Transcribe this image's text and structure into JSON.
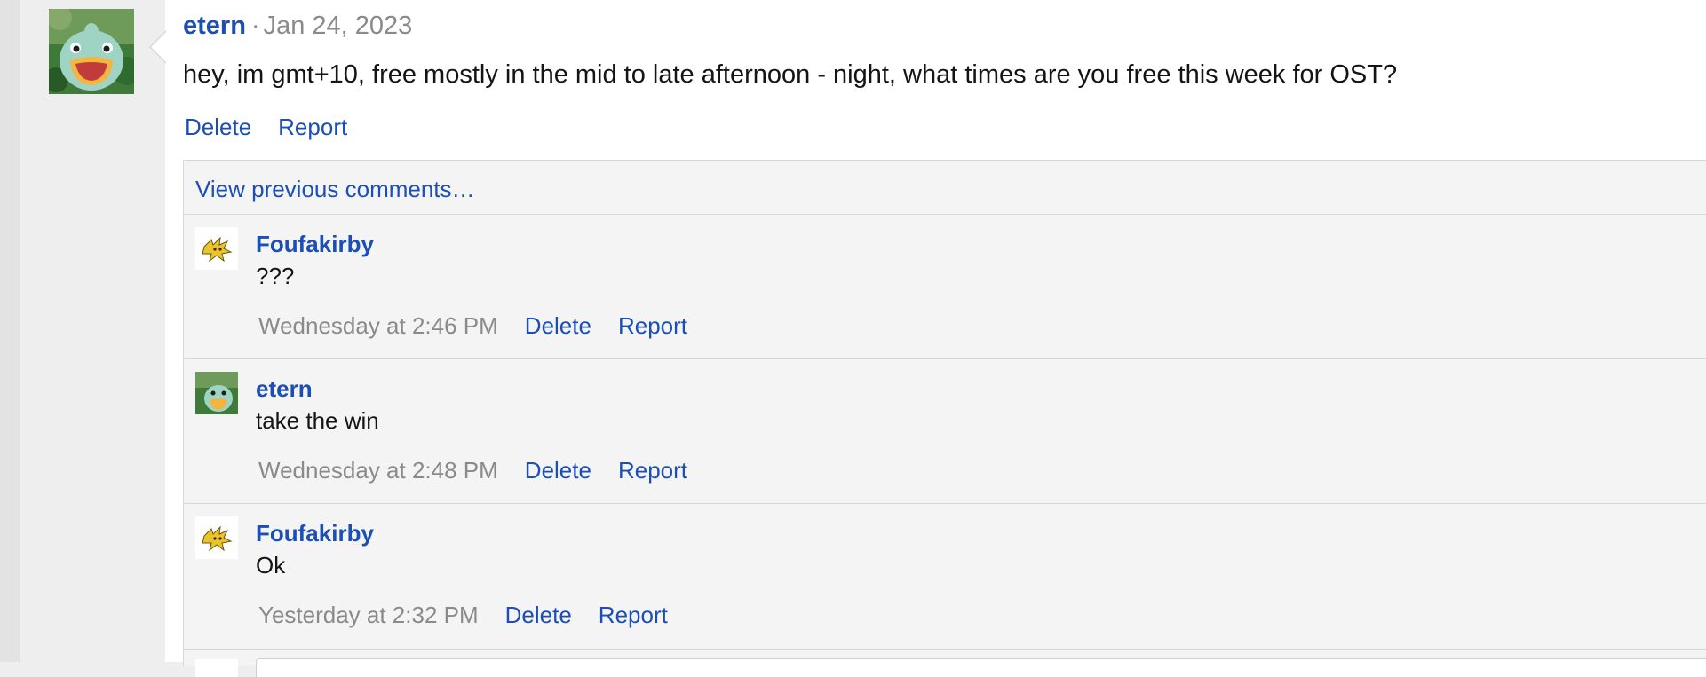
{
  "post": {
    "author": "etern",
    "separator": "·",
    "date": "Jan 24, 2023",
    "body": "hey, im gmt+10, free mostly in the mid to late afternoon - night, what times are you free this week for OST?",
    "actions": {
      "delete": "Delete",
      "report": "Report"
    }
  },
  "comments_section": {
    "view_previous": "View previous comments…",
    "comments": [
      {
        "author": "Foufakirby",
        "text": "???",
        "time": "Wednesday at 2:46 PM",
        "delete": "Delete",
        "report": "Report",
        "avatar": "pokemon-avatar-yellow"
      },
      {
        "author": "etern",
        "text": "take the win",
        "time": "Wednesday at 2:48 PM",
        "delete": "Delete",
        "report": "Report",
        "avatar": "pokemon-avatar-green"
      },
      {
        "author": "Foufakirby",
        "text": "Ok",
        "time": "Yesterday at 2:32 PM",
        "delete": "Delete",
        "report": "Report",
        "avatar": "pokemon-avatar-yellow"
      }
    ]
  },
  "colors": {
    "link": "#1b4fb5",
    "muted": "#8a8a8a",
    "comment_bg": "#f4f4f4",
    "sidebar_bg": "#eeeeee"
  }
}
